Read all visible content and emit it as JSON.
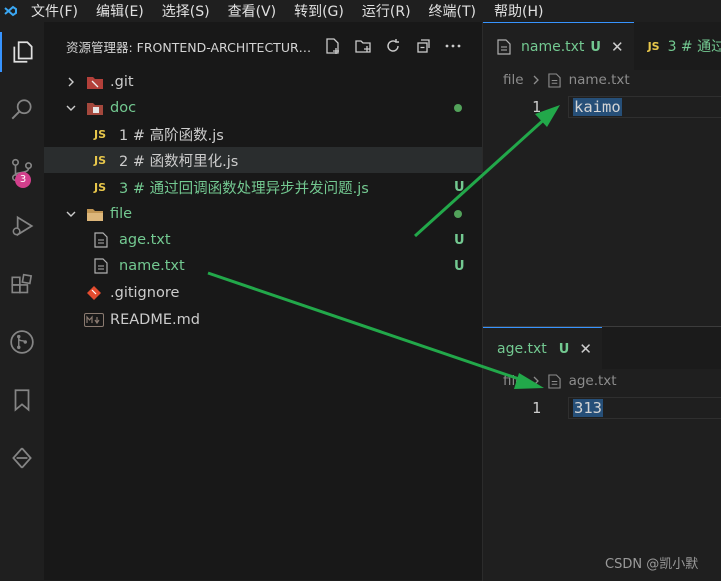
{
  "menu": [
    "文件(F)",
    "编辑(E)",
    "选择(S)",
    "查看(V)",
    "转到(G)",
    "运行(R)",
    "终端(T)",
    "帮助(H)"
  ],
  "activity": {
    "scm_badge": "3"
  },
  "explorer": {
    "title": "资源管理器: FRONTEND-ARCHITECTURE...",
    "items": [
      {
        "label": ".git",
        "status": ""
      },
      {
        "label": "doc",
        "status": ""
      },
      {
        "icon_text": "JS",
        "label": "1 # 高阶函数.js",
        "status": ""
      },
      {
        "icon_text": "JS",
        "label": "2 # 函数柯里化.js",
        "status": ""
      },
      {
        "icon_text": "JS",
        "label": "3 # 通过回调函数处理异步并发问题.js",
        "status": "U"
      },
      {
        "label": "file",
        "status": ""
      },
      {
        "label": "age.txt",
        "status": "U"
      },
      {
        "label": "name.txt",
        "status": "U"
      },
      {
        "label": ".gitignore",
        "status": ""
      },
      {
        "label": "README.md",
        "status": ""
      }
    ]
  },
  "editor_top": {
    "tab1": {
      "label": "name.txt",
      "status": "U",
      "close": "✕"
    },
    "tab2": {
      "icon_text": "JS",
      "label": "3 # 通过"
    },
    "breadcrumb": {
      "folder": "file",
      "file": "name.txt"
    },
    "line_number": "1",
    "content": "kaimo"
  },
  "editor_bottom": {
    "tab1": {
      "label": "age.txt",
      "status": "U",
      "close": "✕"
    },
    "breadcrumb": {
      "folder": "file",
      "file": "age.txt"
    },
    "line_number": "1",
    "content": "313"
  },
  "watermark": "CSDN @凯小默",
  "colors": {
    "accent": "#3794ff",
    "untracked": "#73c991",
    "arrow": "#22a84a"
  }
}
